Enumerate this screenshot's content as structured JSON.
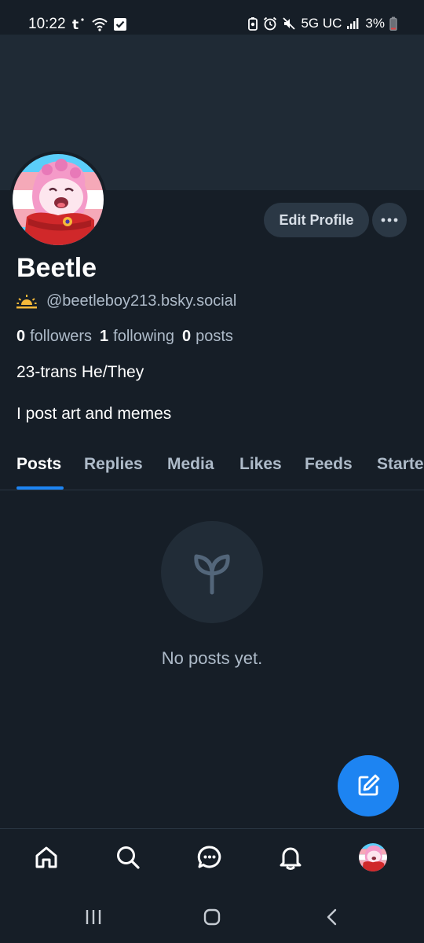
{
  "status_bar": {
    "time": "10:22",
    "network": "5G UC",
    "battery": "3%"
  },
  "profile": {
    "display_name": "Beetle",
    "handle": "@beetleboy213.bsky.social",
    "handle_badge_icon": "sunrise-icon",
    "followers_count": "0",
    "followers_label": "followers",
    "following_count": "1",
    "following_label": "following",
    "posts_count": "0",
    "posts_label": "posts",
    "bio_line1": "23-trans He/They",
    "bio_line2": "I post art and memes"
  },
  "actions": {
    "edit_profile": "Edit Profile",
    "more_icon": "ellipsis-icon"
  },
  "tabs": [
    {
      "label": "Posts",
      "active": true
    },
    {
      "label": "Replies",
      "active": false
    },
    {
      "label": "Media",
      "active": false
    },
    {
      "label": "Likes",
      "active": false
    },
    {
      "label": "Feeds",
      "active": false
    },
    {
      "label": "Starte",
      "active": false
    }
  ],
  "empty_state": {
    "icon": "sprout-icon",
    "text": "No posts yet."
  },
  "fab": {
    "icon": "compose-icon"
  },
  "bottom_nav": [
    {
      "name": "home",
      "icon": "home-icon"
    },
    {
      "name": "search",
      "icon": "search-icon"
    },
    {
      "name": "chat",
      "icon": "chat-icon"
    },
    {
      "name": "notifications",
      "icon": "bell-icon"
    },
    {
      "name": "profile",
      "icon": "avatar"
    }
  ],
  "colors": {
    "background": "#161e27",
    "banner": "#1f2a35",
    "accent": "#1d84f2",
    "muted_text": "#aebbc9",
    "button_bg": "#2b3845"
  }
}
